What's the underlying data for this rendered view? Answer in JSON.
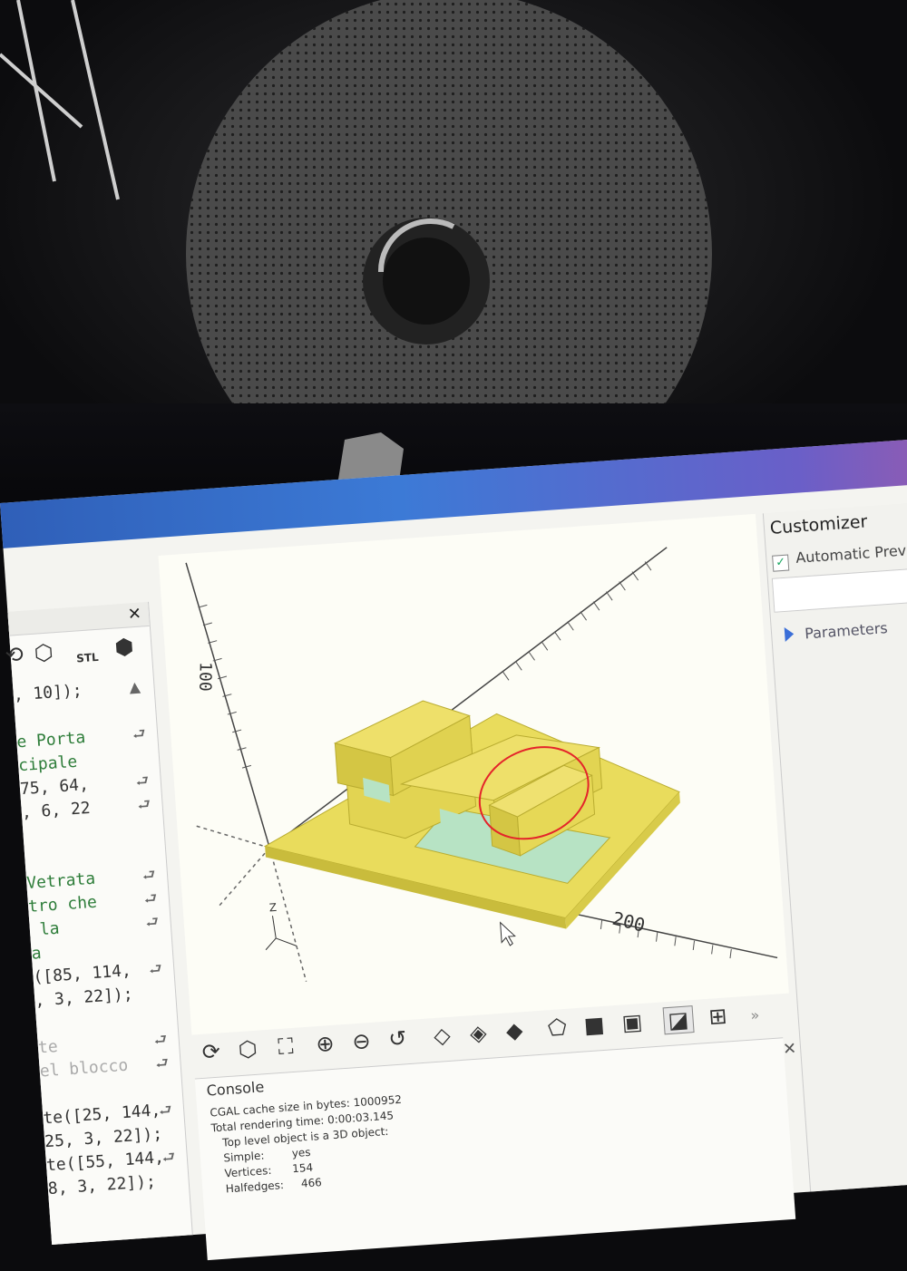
{
  "customizer": {
    "title": "Customizer",
    "automatic_preview_label": "Automatic Previe",
    "parameters_label": "Parameters"
  },
  "editor": {
    "toolbar": {
      "stl_label": "STL"
    },
    "lines": [
      ", 10]);",
      "",
      "e Porta",
      "cipale",
      "75, 64,",
      ", 6, 22",
      "",
      "",
      "Vetrata",
      "tro che",
      " la",
      "a",
      "([85, 114,",
      ", 3, 22]);",
      "",
      "te",
      "el blocco",
      "",
      "te([25, 144,",
      "25, 3, 22]);",
      "te([55, 144,",
      "8, 3, 22]);"
    ]
  },
  "viewport": {
    "axis_labels": {
      "y_100": "100",
      "x_200": "200",
      "z": "Z"
    }
  },
  "console": {
    "title": "Console",
    "lines": [
      "CGAL cache size in bytes: 1000952",
      "Total rendering time: 0:00:03.145",
      "   Top level object is a 3D object:",
      "   Simple:        yes",
      "   Vertices:      154",
      "   Halfedges:     466"
    ]
  },
  "colors": {
    "model_yellow": "#e9dc5c",
    "window_green": "#b7e3c4",
    "annotation_red": "#e4242a"
  }
}
